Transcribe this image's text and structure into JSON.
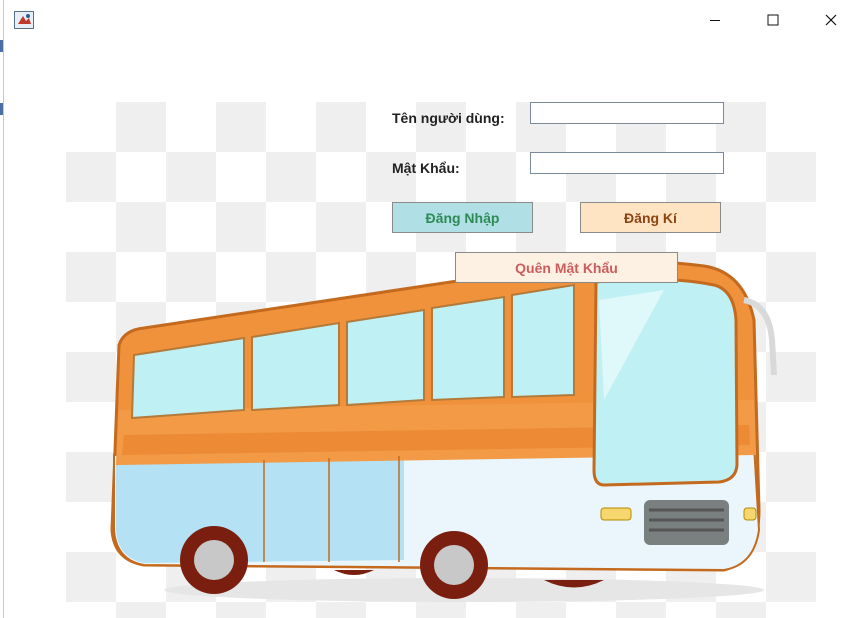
{
  "window": {
    "title": ""
  },
  "form": {
    "username_label": "Tên người dùng:",
    "username_value": "",
    "password_label": "Mật Khẩu:",
    "password_value": ""
  },
  "buttons": {
    "login": "Đăng Nhập",
    "register": "Đăng Kí",
    "forgot": "Quên Mật Khẩu"
  },
  "icons": {
    "app": "java-app-icon",
    "minimize": "minimize-icon",
    "maximize": "maximize-icon",
    "close": "close-icon",
    "illustration": "bus-illustration"
  },
  "colors": {
    "login_bg": "#b0dfe5",
    "login_text": "#2e8b57",
    "register_bg": "#ffe4c4",
    "register_text": "#8b4513",
    "forgot_bg": "#fdf1e4",
    "forgot_text": "#cd5c5c",
    "bus_body": "#f0923b",
    "bus_window": "#bff0f3"
  }
}
